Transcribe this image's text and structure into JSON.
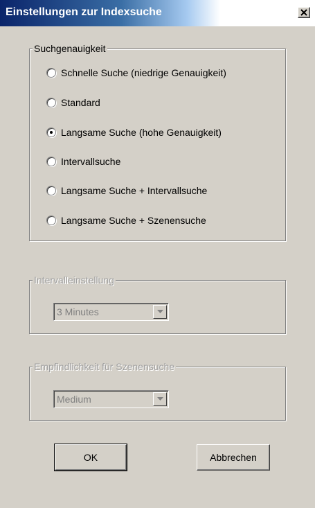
{
  "window": {
    "title": "Einstellungen zur Indexsuche",
    "close_label": "×"
  },
  "accuracy": {
    "legend": "Suchgenauigkeit",
    "options": [
      {
        "label": "Schnelle Suche (niedrige Genauigkeit)",
        "checked": false
      },
      {
        "label": "Standard",
        "checked": false
      },
      {
        "label": "Langsame Suche (hohe Genauigkeit)",
        "checked": true
      },
      {
        "label": "Intervallsuche",
        "checked": false
      },
      {
        "label": "Langsame Suche + Intervallsuche",
        "checked": false
      },
      {
        "label": "Langsame Suche + Szenensuche",
        "checked": false
      }
    ]
  },
  "interval": {
    "legend": "Intervalleinstellung",
    "value": "3 Minutes",
    "enabled": false
  },
  "scene": {
    "legend": "Empfindlichkeit für Szenensuche",
    "value": "Medium",
    "enabled": false
  },
  "buttons": {
    "ok": "OK",
    "cancel": "Abbrechen"
  },
  "colors": {
    "titlebar_start": "#0a246a",
    "face": "#d4d0c8",
    "disabled_text": "#808080"
  }
}
